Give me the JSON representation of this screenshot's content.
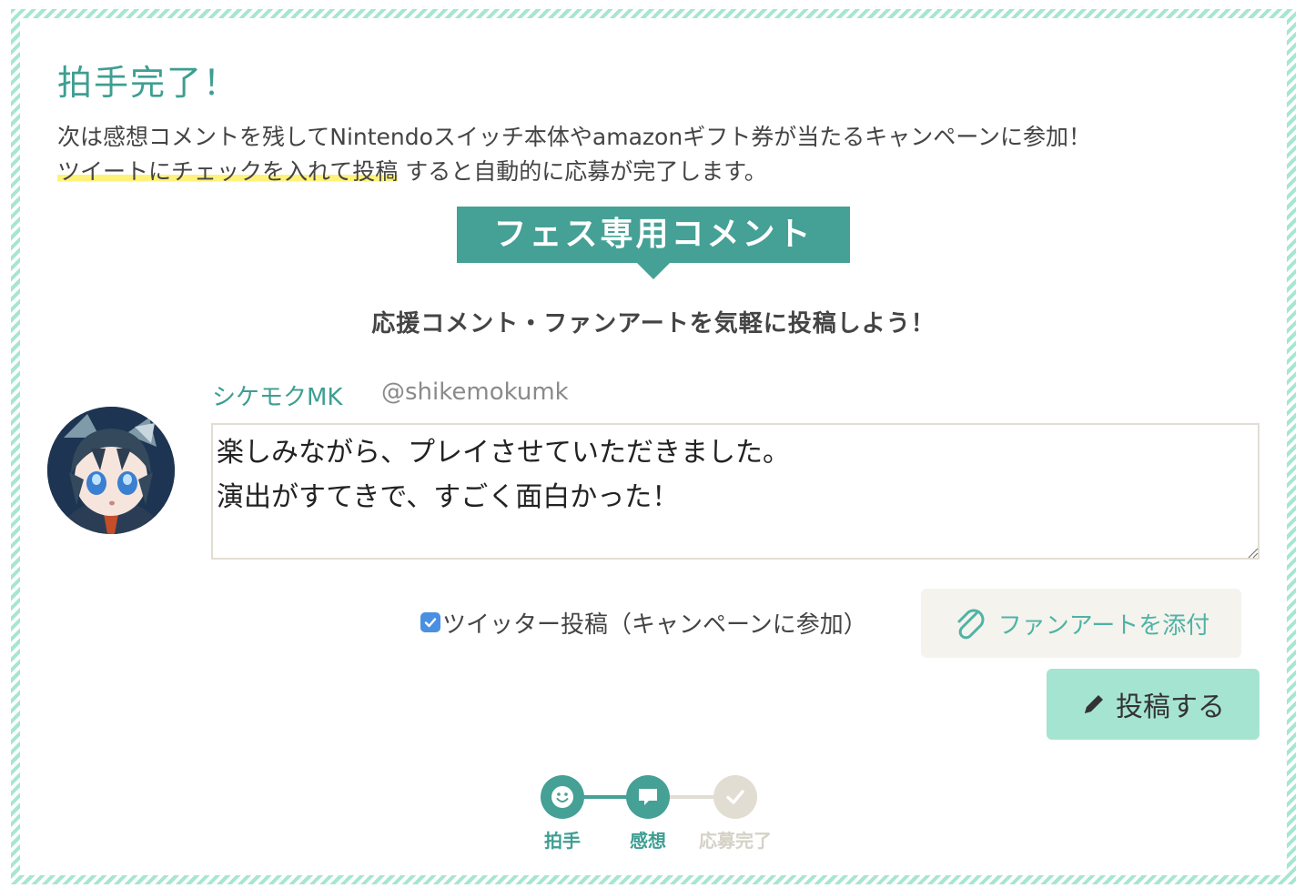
{
  "header": {
    "title": "拍手完了！",
    "lead_line1": "次は感想コメントを残してNintendoスイッチ本体やamazonギフト券が当たるキャンペーンに参加！",
    "lead_highlight": "ツイートにチェックを入れて投稿",
    "lead_line2_rest": "すると自動的に応募が完了します。"
  },
  "section": {
    "ribbon_title": "フェス専用コメント",
    "subtitle": "応援コメント・ファンアートを気軽に投稿しよう！"
  },
  "user": {
    "name": "シケモクMK",
    "handle": "@shikemokumk"
  },
  "comment": {
    "value": "楽しみながら、プレイさせていただきました。\n演出がすてきで、すごく面白かった！"
  },
  "actions": {
    "tweet_label": "ツイッター投稿（キャンペーンに参加）",
    "tweet_checked": true,
    "fanart_label": "ファンアートを添付",
    "post_label": "投稿する"
  },
  "steps": [
    {
      "label": "拍手",
      "icon": "smile-icon",
      "state": "done"
    },
    {
      "label": "感想",
      "icon": "speech-bubble-icon",
      "state": "current"
    },
    {
      "label": "応募完了",
      "icon": "check-icon",
      "state": "pending"
    }
  ],
  "colors": {
    "accent": "#3e9e92",
    "ribbon": "#45a096",
    "border_stripe": "#a6e6d2",
    "highlight": "#fff27a",
    "post_button": "#a6e4d2",
    "checkbox": "#4a90e2",
    "step_pending": "#e2ddd3"
  }
}
